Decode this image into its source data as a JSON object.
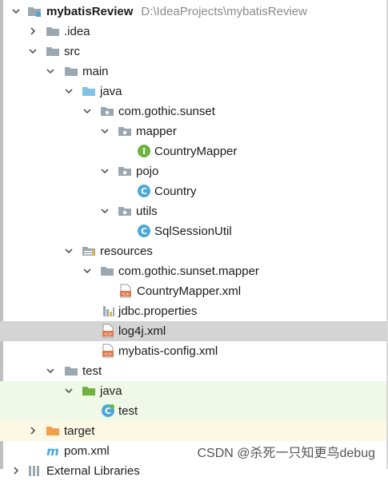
{
  "project": {
    "name": "mybatisReview",
    "path": "D:\\IdeaProjects\\mybatisReview"
  },
  "nodes": {
    "idea": ".idea",
    "src": "src",
    "main": "main",
    "java": "java",
    "pkg": "com.gothic.sunset",
    "mapper": "mapper",
    "countryMapper": "CountryMapper",
    "pojo": "pojo",
    "country": "Country",
    "utils": "utils",
    "sqlSessionUtil": "SqlSessionUtil",
    "resources": "resources",
    "resPkg": "com.gothic.sunset.mapper",
    "countryMapperXml": "CountryMapper.xml",
    "jdbc": "jdbc.properties",
    "log4j": "log4j.xml",
    "mybatisConfig": "mybatis-config.xml",
    "test": "test",
    "testJava": "java",
    "testClass": "test",
    "target": "target",
    "pom": "pom.xml",
    "externalLibs": "External Libraries"
  },
  "watermark": "CSDN @杀死一只知更鸟debug",
  "colors": {
    "selection": "#d4d4d4",
    "folder": "#9aa7b0",
    "sourceFolder": "#7ec3e6",
    "testFolder": "#6db33f",
    "excludedFolder": "#f0a04b",
    "interface": "#6db33f",
    "class": "#4aa8d8",
    "xml": "#e07a4e"
  }
}
